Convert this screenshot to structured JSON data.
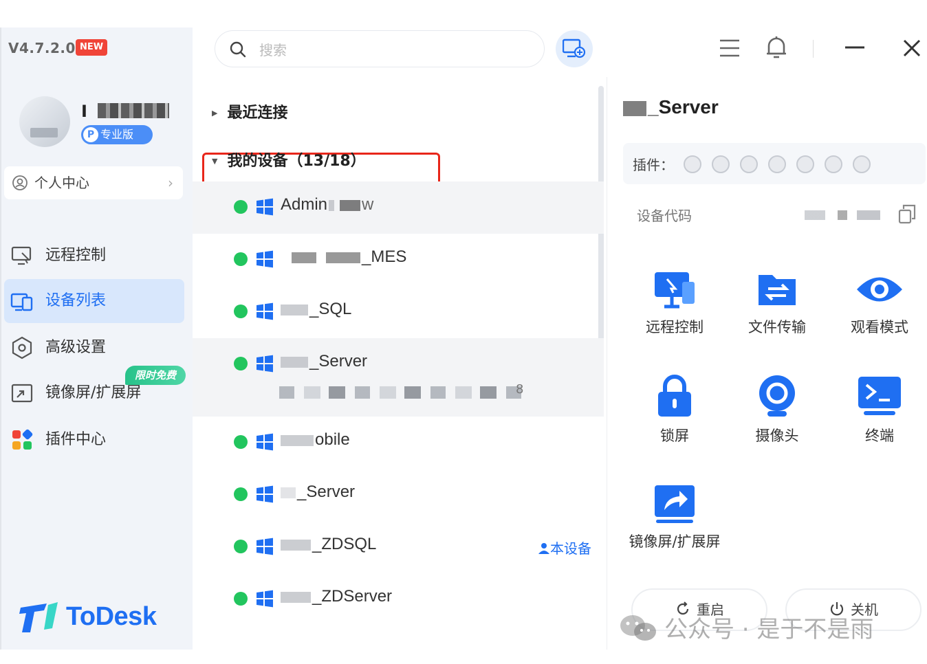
{
  "app": {
    "version": "V4.7.2.0",
    "new_badge": "NEW",
    "brand": "ToDesk"
  },
  "user": {
    "name_initial": "I",
    "edition": "专业版",
    "edition_letter": "P",
    "personal_center": "个人中心"
  },
  "sidebar": {
    "items": [
      {
        "label": "远程控制",
        "icon": "remote-control-icon"
      },
      {
        "label": "设备列表",
        "icon": "device-list-icon",
        "active": true
      },
      {
        "label": "高级设置",
        "icon": "settings-icon"
      },
      {
        "label": "镜像屏/扩展屏",
        "icon": "mirror-screen-icon"
      },
      {
        "label": "插件中心",
        "icon": "plugin-center-icon"
      }
    ],
    "free_tag": "限时免费"
  },
  "search": {
    "placeholder": "搜索"
  },
  "groups": {
    "recent": "最近连接",
    "mine": "我的设备（13/18）"
  },
  "devices": [
    {
      "name": "Admin",
      "suffix": "w",
      "status": "online"
    },
    {
      "name": "_MES",
      "status": "online"
    },
    {
      "name": "_SQL",
      "status": "online"
    },
    {
      "name": "_Server",
      "status": "online",
      "selected": true,
      "sub_suffix": "8"
    },
    {
      "name": "obile",
      "status": "online"
    },
    {
      "name": "_Server",
      "status": "online"
    },
    {
      "name": "_ZDSQL",
      "status": "online",
      "tag": "本设备"
    },
    {
      "name": "_ZDServer",
      "status": "online"
    }
  ],
  "detail": {
    "title": "_Server",
    "title_partial": "erver",
    "plugins_label": "插件：",
    "code_label": "设备代码",
    "actions": [
      {
        "label": "远程控制",
        "icon": "remote-desktop-icon"
      },
      {
        "label": "文件传输",
        "icon": "file-transfer-icon"
      },
      {
        "label": "观看模式",
        "icon": "eye-icon"
      },
      {
        "label": "锁屏",
        "icon": "lock-icon"
      },
      {
        "label": "摄像头",
        "icon": "camera-icon"
      },
      {
        "label": "终端",
        "icon": "terminal-icon"
      },
      {
        "label": "镜像屏/扩展屏",
        "icon": "mirror-share-icon"
      }
    ],
    "restart": "重启",
    "shutdown": "关机"
  },
  "watermark": "公众号 · 是于不是雨",
  "colors": {
    "accent": "#1f6ff2",
    "online": "#22c55e",
    "highlight_border": "#e8261a"
  }
}
